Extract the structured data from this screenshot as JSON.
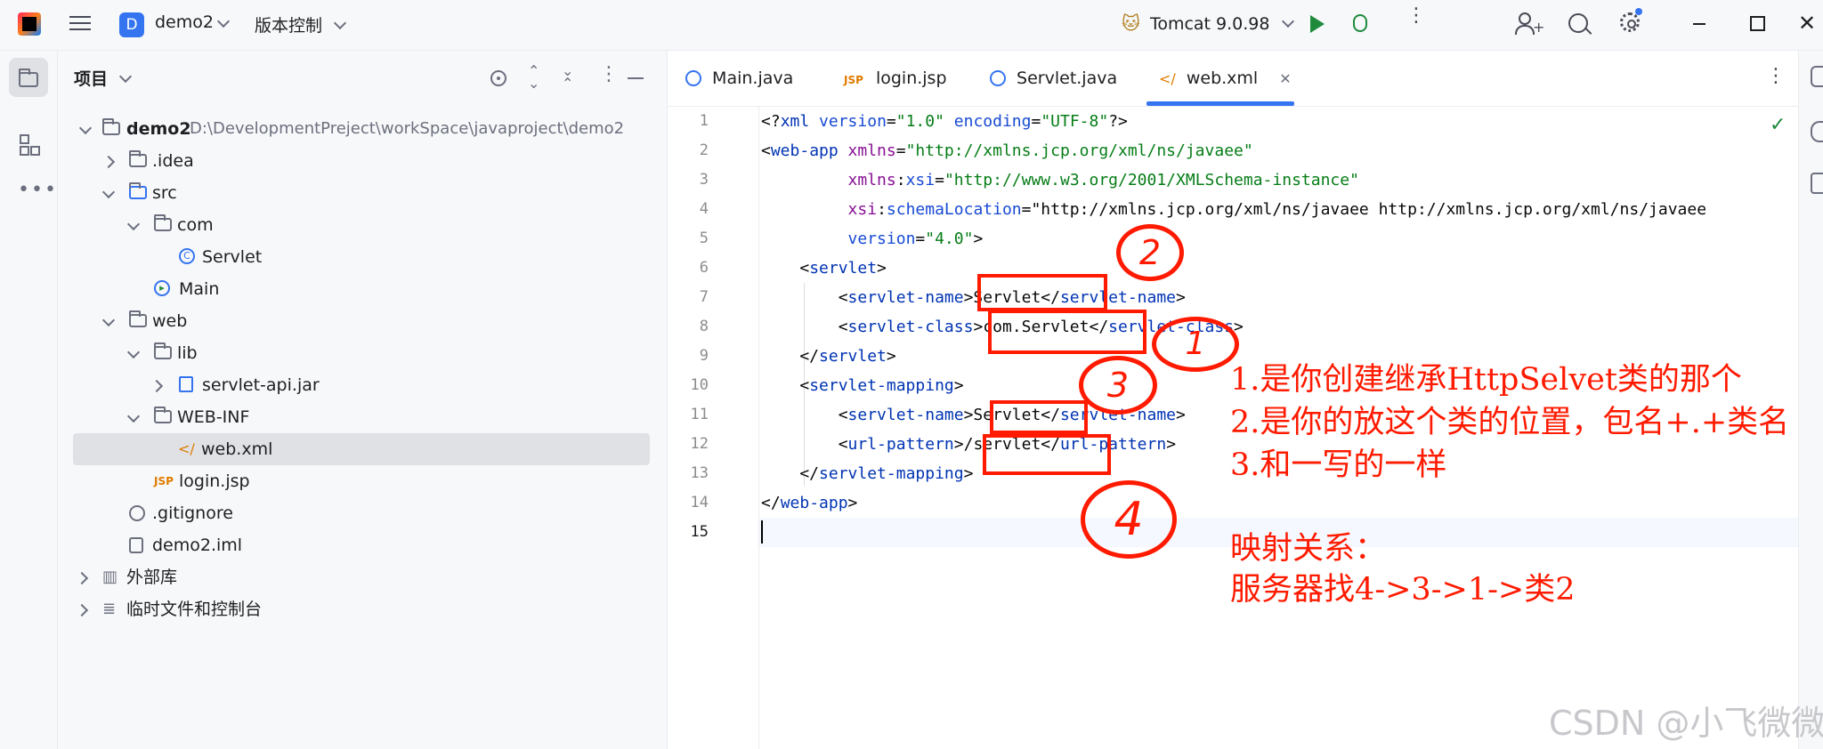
{
  "titlebar": {
    "project_badge": "D",
    "project_name": "demo2",
    "vcs_label": "版本控制",
    "run_config": "Tomcat 9.0.98"
  },
  "project_panel": {
    "title": "项目",
    "tree": [
      {
        "label": "demo2",
        "path": "D:\\DevelopmentPreject\\workSpace\\javaproject\\demo2",
        "icon": "module-folder-icon"
      },
      {
        "label": ".idea",
        "icon": "folder-icon"
      },
      {
        "label": "src",
        "icon": "source-folder-icon"
      },
      {
        "label": "com",
        "icon": "package-icon"
      },
      {
        "label": "Servlet",
        "icon": "class-icon"
      },
      {
        "label": "Main",
        "icon": "main-class-icon"
      },
      {
        "label": "web",
        "icon": "web-folder-icon"
      },
      {
        "label": "lib",
        "icon": "folder-icon"
      },
      {
        "label": "servlet-api.jar",
        "icon": "jar-icon"
      },
      {
        "label": "WEB-INF",
        "icon": "folder-icon"
      },
      {
        "label": "web.xml",
        "icon": "xml-icon"
      },
      {
        "label": "login.jsp",
        "icon": "jsp-icon"
      },
      {
        "label": ".gitignore",
        "icon": "ignore-icon"
      },
      {
        "label": "demo2.iml",
        "icon": "iml-icon"
      },
      {
        "label": "外部库",
        "icon": "library-icon"
      },
      {
        "label": "临时文件和控制台",
        "icon": "scratches-icon"
      }
    ]
  },
  "tabs": [
    {
      "label": "Main.java",
      "icon": "main-class-icon"
    },
    {
      "label": "login.jsp",
      "icon": "jsp-icon",
      "badge": "JSP"
    },
    {
      "label": "Servlet.java",
      "icon": "class-icon"
    },
    {
      "label": "web.xml",
      "icon": "xml-icon",
      "active": true
    }
  ],
  "editor": {
    "line_numbers": [
      "1",
      "2",
      "3",
      "4",
      "5",
      "6",
      "7",
      "8",
      "9",
      "10",
      "11",
      "12",
      "13",
      "14",
      "15"
    ],
    "lines": [
      "<?xml version=\"1.0\" encoding=\"UTF-8\"?>",
      "<web-app xmlns=\"http://xmlns.jcp.org/xml/ns/javaee\"",
      "         xmlns:xsi=\"http://www.w3.org/2001/XMLSchema-instance\"",
      "         xsi:schemaLocation=\"http://xmlns.jcp.org/xml/ns/javaee http://xmlns.jcp.org/xml/ns/javaee",
      "         version=\"4.0\">",
      "    <servlet>",
      "        <servlet-name>Servlet</servlet-name>",
      "        <servlet-class>com.Servlet</servlet-class>",
      "    </servlet>",
      "    <servlet-mapping>",
      "        <servlet-name>Servlet</servlet-name>",
      "        <url-pattern>/servlet</url-pattern>",
      "    </servlet-mapping>",
      "</web-app>",
      ""
    ]
  },
  "annotations": {
    "marks": [
      "2",
      "1",
      "3",
      "4"
    ],
    "notes": [
      "1.是你创建继承HttpSelvet类的那个",
      "2.是你的放这个类的位置，包名+.+类名",
      "3.和一写的一样"
    ],
    "mapping_title": "映射关系：",
    "mapping_text": "服务器找4->3->1->类2"
  },
  "watermark": "CSDN @小飞微微",
  "colors": {
    "annotation_red": "#ff1a00",
    "tag_blue": "#0033b3",
    "string_green": "#067d17",
    "accent": "#3574f0"
  }
}
